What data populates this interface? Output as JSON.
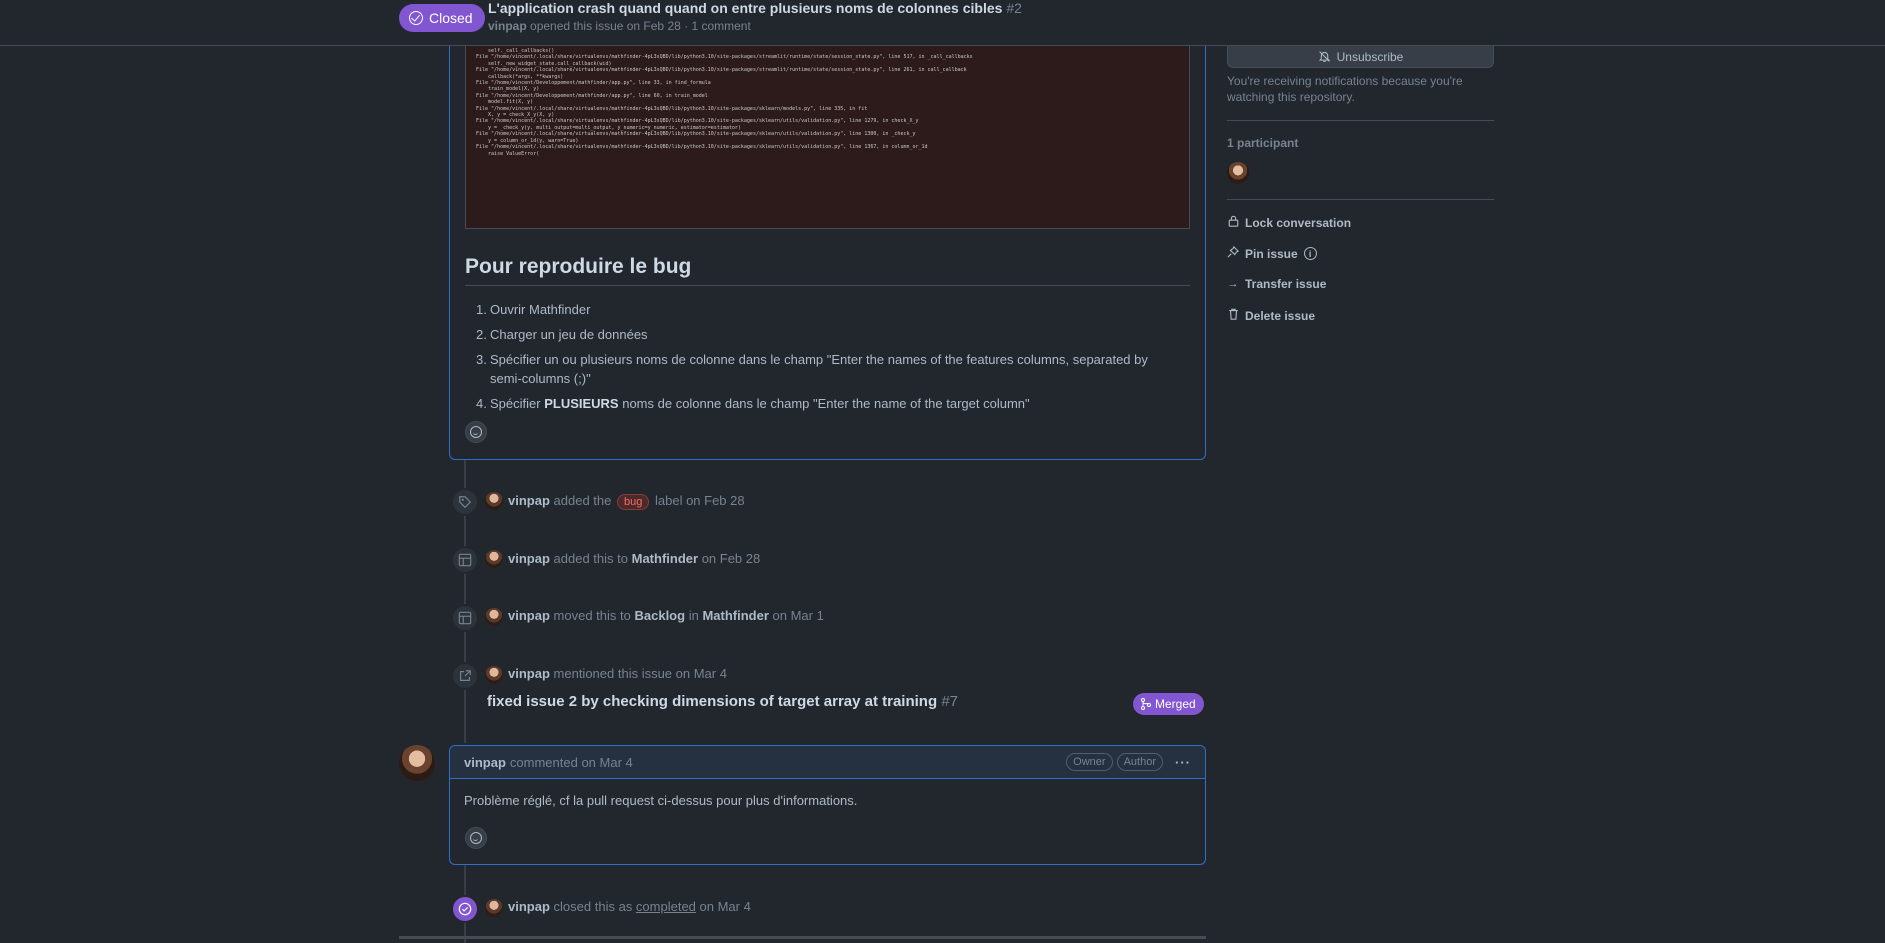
{
  "header": {
    "state": "Closed",
    "title": "L'application crash quand quand on entre plusieurs noms de colonnes cibles",
    "number": "#2",
    "author": "vinpap",
    "meta_rest": "opened this issue on Feb 28 · 1 comment"
  },
  "traceback": [
    "    self._call_callbacks()",
    "File \"/home/vincent/.local/share/virtualenvs/mathfinder-4pL3sQBD/lib/python3.10/site-packages/streamlit/runtime/state/session_state.py\", line 517, in _call_callbacks",
    "    self._new_widget_state.call_callback(wid)",
    "File \"/home/vincent/.local/share/virtualenvs/mathfinder-4pL3sQBD/lib/python3.10/site-packages/streamlit/runtime/state/session_state.py\", line 261, in call_callback",
    "    callback(*args, **kwargs)",
    "File \"/home/vincent/Developpement/mathfinder/app.py\", line 33, in find_formula",
    "    train_model(X, y)",
    "File \"/home/vincent/Developpement/mathfinder/app.py\", line 60, in train_model",
    "    model.fit(X, y)",
    "File \"/home/vincent/.local/share/virtualenvs/mathfinder-4pL3sQBD/lib/python3.10/site-packages/sklearn/models.py\", line 335, in fit",
    "    X, y = check_X_y(X, y)",
    "File \"/home/vincent/.local/share/virtualenvs/mathfinder-4pL3sQBD/lib/python3.10/site-packages/sklearn/utils/validation.py\", line 1279, in check_X_y",
    "    y = _check_y(y, multi_output=multi_output, y_numeric=y_numeric, estimator=estimator)",
    "File \"/home/vincent/.local/share/virtualenvs/mathfinder-4pL3sQBD/lib/python3.10/site-packages/sklearn/utils/validation.py\", line 1300, in _check_y",
    "    y = column_or_1d(y, warn=True)",
    "File \"/home/vincent/.local/share/virtualenvs/mathfinder-4pL3sQBD/lib/python3.10/site-packages/sklearn/utils/validation.py\", line 1367, in column_or_1d",
    "    raise ValueError("
  ],
  "body": {
    "heading": "Pour reproduire le bug",
    "steps": [
      {
        "n": "1.",
        "text": "Ouvrir Mathfinder"
      },
      {
        "n": "2.",
        "text": "Charger un jeu de données"
      },
      {
        "n": "3.",
        "text": "Spécifier un ou plusieurs noms de colonne dans le champ \"Enter the names of the features columns, separated by semi-columns (;)\""
      },
      {
        "n": "4.",
        "pre": "Spécifier ",
        "bold": "PLUSIEURS",
        "post": " noms de colonne dans le champ \"Enter the name of the target column\""
      }
    ]
  },
  "events": {
    "label": {
      "user": "vinpap",
      "pre": "added the",
      "label": "bug",
      "post": "label on Feb 28"
    },
    "project": {
      "user": "vinpap",
      "pre": "added this to",
      "project": "Mathfinder",
      "post": "on Feb 28"
    },
    "moved": {
      "user": "vinpap",
      "pre": "moved this to",
      "column": "Backlog",
      "mid": "in",
      "project": "Mathfinder",
      "post": "on Mar 1"
    },
    "mention": {
      "user": "vinpap",
      "text": "mentioned this issue on Mar 4"
    },
    "pr": {
      "title": "fixed issue 2 by checking dimensions of target array at training",
      "number": "#7",
      "status": "Merged"
    },
    "closed": {
      "user": "vinpap",
      "pre": "closed this as",
      "reason": "completed",
      "post": "on Mar 4"
    }
  },
  "comment": {
    "author": "vinpap",
    "meta": "commented on Mar 4",
    "roles": [
      "Owner",
      "Author"
    ],
    "text": "Problème réglé, cf la pull request ci-dessus pour plus d'informations."
  },
  "sidebar": {
    "unsubscribe": "Unsubscribe",
    "notif": "You're receiving notifications because you're watching this repository.",
    "participants": "1 participant",
    "actions": {
      "lock": "Lock conversation",
      "pin": "Pin issue",
      "transfer": "Transfer issue",
      "delete": "Delete issue"
    }
  },
  "colors": {
    "accent_purple": "#8256d0",
    "border_blue": "#316dca",
    "bug_label": "#f47067",
    "background": "#22272e"
  }
}
